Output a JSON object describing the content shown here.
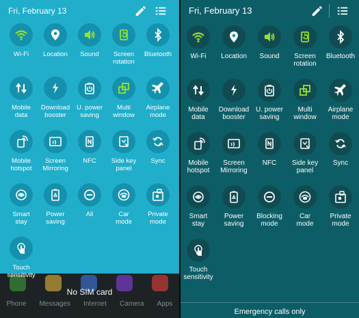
{
  "colors": {
    "left_bg": "#20aecb",
    "right_bg": "#0d5d66",
    "active_green": "#9be02c",
    "inactive_white": "#ffffff"
  },
  "left": {
    "date": "Fri, February 13",
    "no_sim": "No SIM card",
    "dock": [
      "Phone",
      "Messages",
      "Internet",
      "Camera",
      "Apps"
    ],
    "tiles": [
      {
        "label": "Wi-Fi",
        "icon": "wifi-icon",
        "active": true
      },
      {
        "label": "Location",
        "icon": "location-icon",
        "active": false
      },
      {
        "label": "Sound",
        "icon": "sound-icon",
        "active": true
      },
      {
        "label": "Screen\nrotation",
        "icon": "screen-rotation-icon",
        "active": true
      },
      {
        "label": "Bluetooth",
        "icon": "bluetooth-icon",
        "active": false
      },
      {
        "label": "Mobile\ndata",
        "icon": "mobile-data-icon",
        "active": false
      },
      {
        "label": "Download\nbooster",
        "icon": "download-booster-icon",
        "active": false
      },
      {
        "label": "U. power\nsaving",
        "icon": "power-saving-icon",
        "active": false
      },
      {
        "label": "Multi\nwindow",
        "icon": "multi-window-icon",
        "active": true
      },
      {
        "label": "Airplane\nmode",
        "icon": "airplane-icon",
        "active": false
      },
      {
        "label": "Mobile\nhotspot",
        "icon": "hotspot-icon",
        "active": false
      },
      {
        "label": "Screen\nMirroring",
        "icon": "screen-mirroring-icon",
        "active": false
      },
      {
        "label": "NFC",
        "icon": "nfc-icon",
        "active": false
      },
      {
        "label": "Side key\npanel",
        "icon": "side-key-panel-icon",
        "active": false
      },
      {
        "label": "Sync",
        "icon": "sync-icon",
        "active": false
      },
      {
        "label": "Smart\nstay",
        "icon": "smart-stay-icon",
        "active": false
      },
      {
        "label": "Power\nsaving",
        "icon": "recycle-icon",
        "active": false
      },
      {
        "label": "All",
        "icon": "minus-circle-icon",
        "active": false
      },
      {
        "label": "Car\nmode",
        "icon": "car-mode-icon",
        "active": false
      },
      {
        "label": "Private\nmode",
        "icon": "private-mode-icon",
        "active": false
      },
      {
        "label": "Touch\nsensitivity",
        "icon": "touch-icon",
        "active": false
      }
    ]
  },
  "right": {
    "date": "Fri, February 13",
    "footer": "Emergency calls only",
    "tiles": [
      {
        "label": "Wi-Fi",
        "icon": "wifi-icon",
        "active": true
      },
      {
        "label": "Location",
        "icon": "location-icon",
        "active": false
      },
      {
        "label": "Sound",
        "icon": "sound-icon",
        "active": true
      },
      {
        "label": "Screen\nrotation",
        "icon": "screen-rotation-icon",
        "active": true
      },
      {
        "label": "Bluetooth",
        "icon": "bluetooth-icon",
        "active": false
      },
      {
        "label": "Mobile\ndata",
        "icon": "mobile-data-icon",
        "active": false
      },
      {
        "label": "Download\nbooster",
        "icon": "download-booster-icon",
        "active": false
      },
      {
        "label": "U. power\nsaving",
        "icon": "power-saving-icon",
        "active": false
      },
      {
        "label": "Multi\nwindow",
        "icon": "multi-window-icon",
        "active": true
      },
      {
        "label": "Airplane\nmode",
        "icon": "airplane-icon",
        "active": false
      },
      {
        "label": "Mobile\nhotspot",
        "icon": "hotspot-icon",
        "active": false
      },
      {
        "label": "Screen\nMirroring",
        "icon": "screen-mirroring-icon",
        "active": false
      },
      {
        "label": "NFC",
        "icon": "nfc-icon",
        "active": false
      },
      {
        "label": "Side key\npanel",
        "icon": "side-key-panel-icon",
        "active": false
      },
      {
        "label": "Sync",
        "icon": "sync-icon",
        "active": false
      },
      {
        "label": "Smart\nstay",
        "icon": "smart-stay-icon",
        "active": false
      },
      {
        "label": "Power\nsaving",
        "icon": "recycle-icon",
        "active": false
      },
      {
        "label": "Blocking\nmode",
        "icon": "blocking-mode-icon",
        "active": false
      },
      {
        "label": "Car\nmode",
        "icon": "car-mode-icon",
        "active": false
      },
      {
        "label": "Private\nmode",
        "icon": "private-mode-icon",
        "active": false
      },
      {
        "label": "Touch\nsensitivity",
        "icon": "touch-icon",
        "active": false
      }
    ]
  }
}
